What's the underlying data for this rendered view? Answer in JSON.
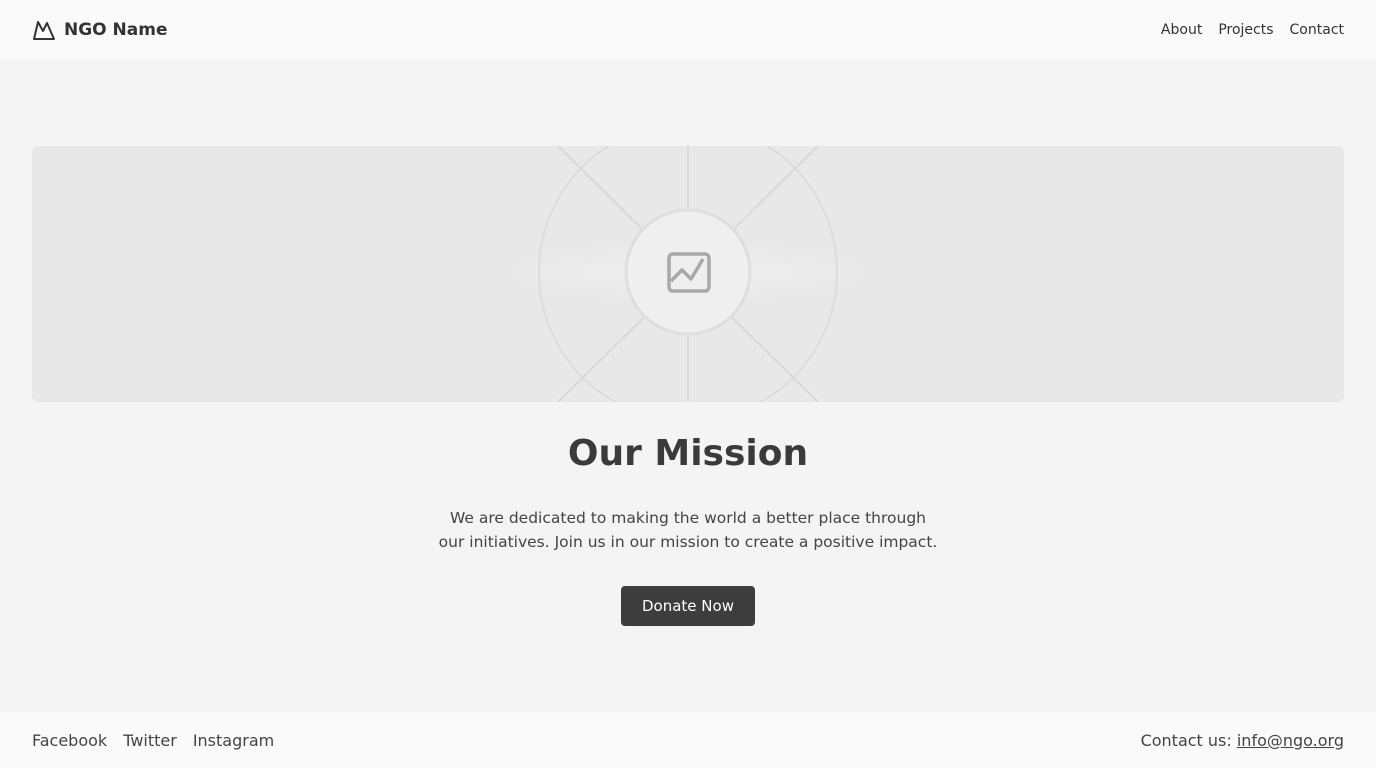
{
  "header": {
    "brand_name": "NGO Name",
    "logo_icon": "mountain-icon",
    "nav": [
      {
        "label": "About"
      },
      {
        "label": "Projects"
      },
      {
        "label": "Contact"
      }
    ]
  },
  "hero": {
    "image_icon": "image-placeholder-icon"
  },
  "mission": {
    "title": "Our Mission",
    "text": "We are dedicated to making the world a better place through our initiatives. Join us in our mission to create a positive impact.",
    "button_label": "Donate Now"
  },
  "footer": {
    "social": [
      {
        "label": "Facebook"
      },
      {
        "label": "Twitter"
      },
      {
        "label": "Instagram"
      }
    ],
    "contact_prefix": "Contact us:",
    "contact_email": "info@ngo.org"
  },
  "colors": {
    "page_bg": "#f4f4f4",
    "bar_bg": "#fafafa",
    "button_bg": "#3d3d3d",
    "text": "#3c3c3c"
  }
}
